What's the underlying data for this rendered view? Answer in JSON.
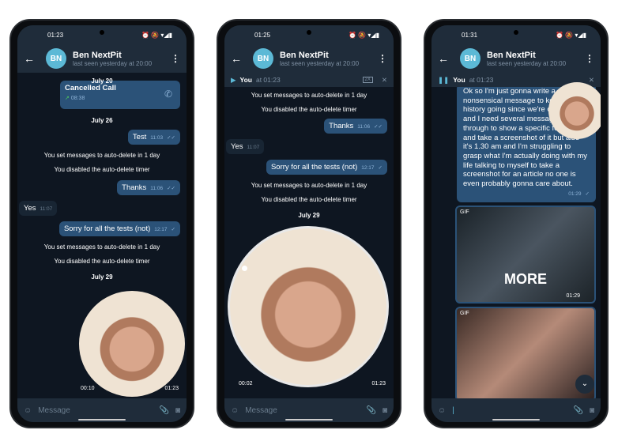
{
  "contact": {
    "initials": "BN",
    "name": "Ben NextPit",
    "last_seen": "last seen yesterday at 20:00"
  },
  "input_placeholder": "Message",
  "phone1": {
    "time": "01:23",
    "date1": "July 20",
    "call_title": "Cancelled Call",
    "call_time": "08:38",
    "date2": "July 26",
    "m_test": "Test",
    "t_test": "11:03",
    "sys1": "You set messages to auto-delete in 1 day",
    "sys2": "You disabled the auto-delete timer",
    "m_thanks": "Thanks",
    "t_thanks": "11:06",
    "m_yes": "Yes",
    "t_yes": "11:07",
    "m_sorry": "Sorry for all the tests (not)",
    "t_sorry": "12:17",
    "date3": "July 29",
    "video_duration": "00:10",
    "video_time": "01:23"
  },
  "phone2": {
    "time": "01:25",
    "player_you": "You",
    "player_at": "at 01:23",
    "speed": "2X",
    "video_duration": "00:02",
    "video_time": "01:23",
    "video_progress": 0.1
  },
  "phone3": {
    "time": "01:31",
    "player_you": "You",
    "player_at": "at 01:23",
    "long_message": "Ok so I'm just gonna write a nonsensical message to keep the history going since we're on Telegram and I need several messages to scroll through to show a specific feature and take a screenshot of it but also it's 1.30 am and I'm struggling to grasp what I'm actually doing with my life talking to myself to take a screenshot for an article no one is even probably gonna care about.",
    "long_time": "01:29",
    "gif_label": "GIF",
    "gif1_caption": "MORE",
    "gif1_time": "01:29",
    "gif2_label": "GIF"
  },
  "colors": {
    "bubble_out": "#2b5278",
    "background": "#0e1621",
    "header": "#1f2c3a",
    "accent": "#5cb9d6"
  }
}
